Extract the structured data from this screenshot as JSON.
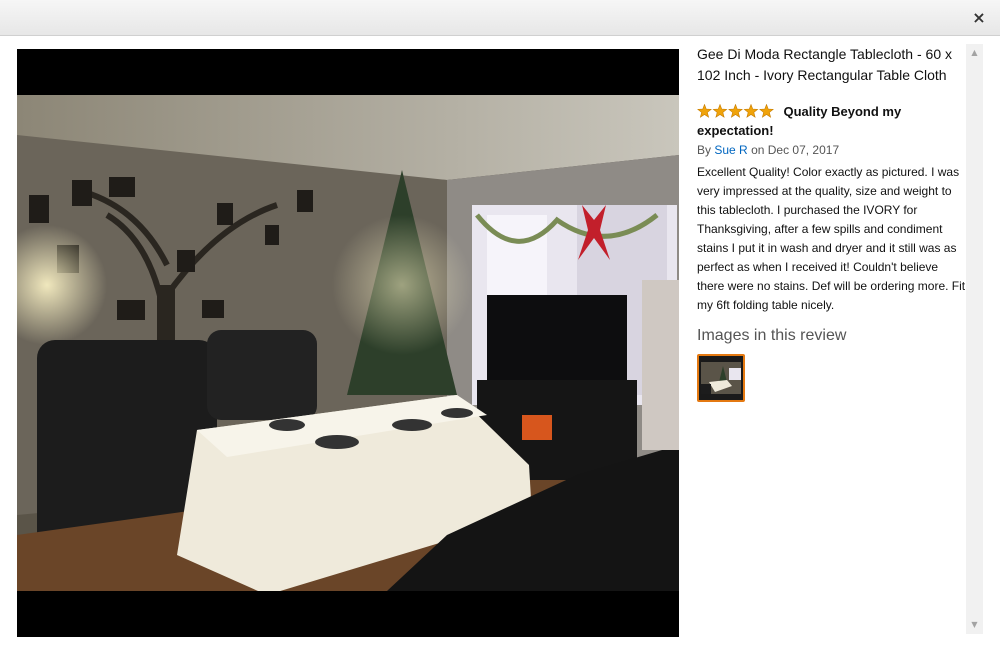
{
  "modal": {
    "close_glyph": "×",
    "close_icon": "close-icon"
  },
  "product": {
    "title": "Gee Di Moda Rectangle Tablecloth - 60 x 102 Inch - Ivory Rectangular Table Cloth"
  },
  "review": {
    "rating": 5,
    "star_color": "#f0a30a",
    "title": "Quality Beyond my expectation!",
    "by_prefix": "By",
    "author": "Sue R",
    "date_text": "on Dec 07, 2017",
    "body": "Excellent Quality! Color exactly as pictured. I was very impressed at the quality, size and weight to this tablecloth. I purchased the IVORY for Thanksgiving, after a few spills and condiment stains I put it in wash and dryer and it still was as perfect as when I received it! Couldn't believe there were no stains. Def will be ordering more. Fit my 6ft folding table nicely."
  },
  "images_section": {
    "heading": "Images in this review",
    "selected_border_color": "#e47911"
  },
  "scrollbar": {
    "up_glyph": "▲",
    "down_glyph": "▼"
  }
}
